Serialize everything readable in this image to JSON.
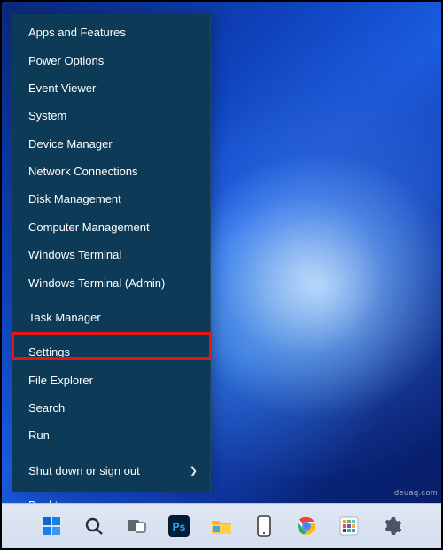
{
  "watermark": "deuaq.com",
  "menu": {
    "groups": [
      [
        "Apps and Features",
        "Power Options",
        "Event Viewer",
        "System",
        "Device Manager",
        "Network Connections",
        "Disk Management",
        "Computer Management",
        "Windows Terminal",
        "Windows Terminal (Admin)"
      ],
      [
        "Task Manager"
      ],
      [
        "Settings",
        "File Explorer",
        "Search",
        "Run"
      ],
      [
        "Shut down or sign out"
      ],
      [
        "Desktop"
      ]
    ],
    "submenu_items": [
      "Shut down or sign out"
    ],
    "highlighted_item": "Settings"
  },
  "taskbar": {
    "icons": [
      "start",
      "search",
      "taskview",
      "photoshop",
      "explorer",
      "tablet",
      "chrome",
      "app",
      "settings"
    ]
  },
  "colors": {
    "menu_bg": "#0d3a56",
    "highlight_border": "#e11717",
    "taskbar_bg": "#d9e2f1"
  }
}
